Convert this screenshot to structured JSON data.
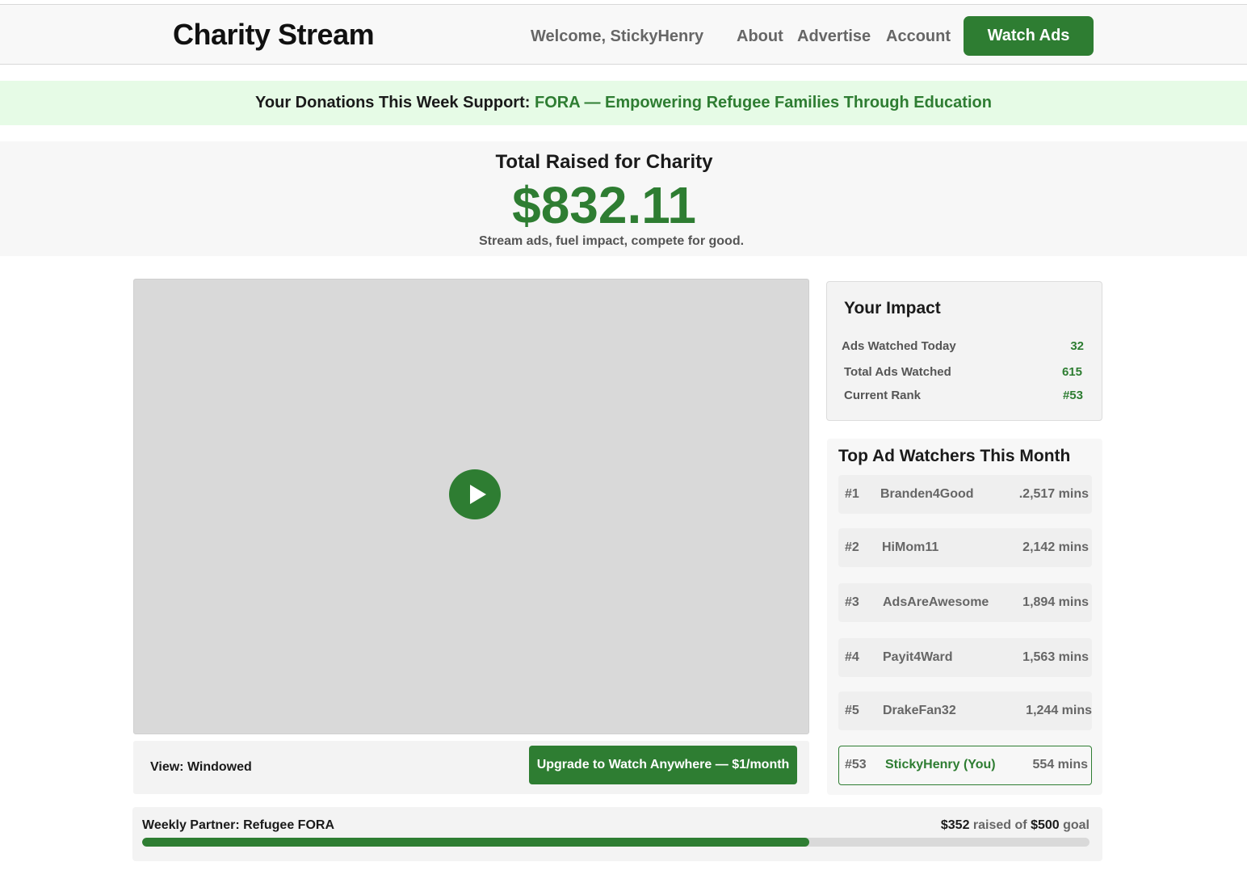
{
  "header": {
    "brand": "Charity Stream",
    "welcome": "Welcome, StickyHenry",
    "nav": [
      "About",
      "Advertise",
      "Account"
    ],
    "cta": "Watch Ads"
  },
  "banner": {
    "prefix": "Your Donations This Week Support:",
    "charity": "FORA — Empowering Refugee Families Through Education"
  },
  "hero": {
    "title": "Total Raised for Charity",
    "amount": "$832.11",
    "subtitle": "Stream ads, fuel impact, compete for good."
  },
  "player": {
    "view_label": "View: Windowed",
    "upgrade_label": "Upgrade to Watch Anywhere — $1/month"
  },
  "impact": {
    "title": "Your Impact",
    "rows": [
      {
        "label": "Ads Watched Today",
        "value": "32"
      },
      {
        "label": "Total Ads Watched",
        "value": "615"
      },
      {
        "label": "Current Rank",
        "value": "#53"
      }
    ]
  },
  "leaderboard": {
    "title": "Top Ad Watchers This Month",
    "rows": [
      {
        "rank": "#1",
        "name": "Branden4Good",
        "mins": ".2,517 mins"
      },
      {
        "rank": "#2",
        "name": "HiMom11",
        "mins": "2,142 mins"
      },
      {
        "rank": "#3",
        "name": "AdsAreAwesome",
        "mins": "1,894 mins"
      },
      {
        "rank": "#4",
        "name": "Payit4Ward",
        "mins": "1,563 mins"
      },
      {
        "rank": "#5",
        "name": "DrakeFan32",
        "mins": "1,244 mins"
      },
      {
        "rank": "#53",
        "name": "StickyHenry (You)",
        "mins": "554 mins"
      }
    ]
  },
  "goal": {
    "label": "Weekly Partner: Refugee FORA",
    "raised": "$352",
    "raised_text": "raised of",
    "target": "$500",
    "goal_text": "goal",
    "progress_fraction": 0.704
  },
  "colors": {
    "accent": "#2e7d32",
    "banner_bg": "#e6fbe6"
  }
}
